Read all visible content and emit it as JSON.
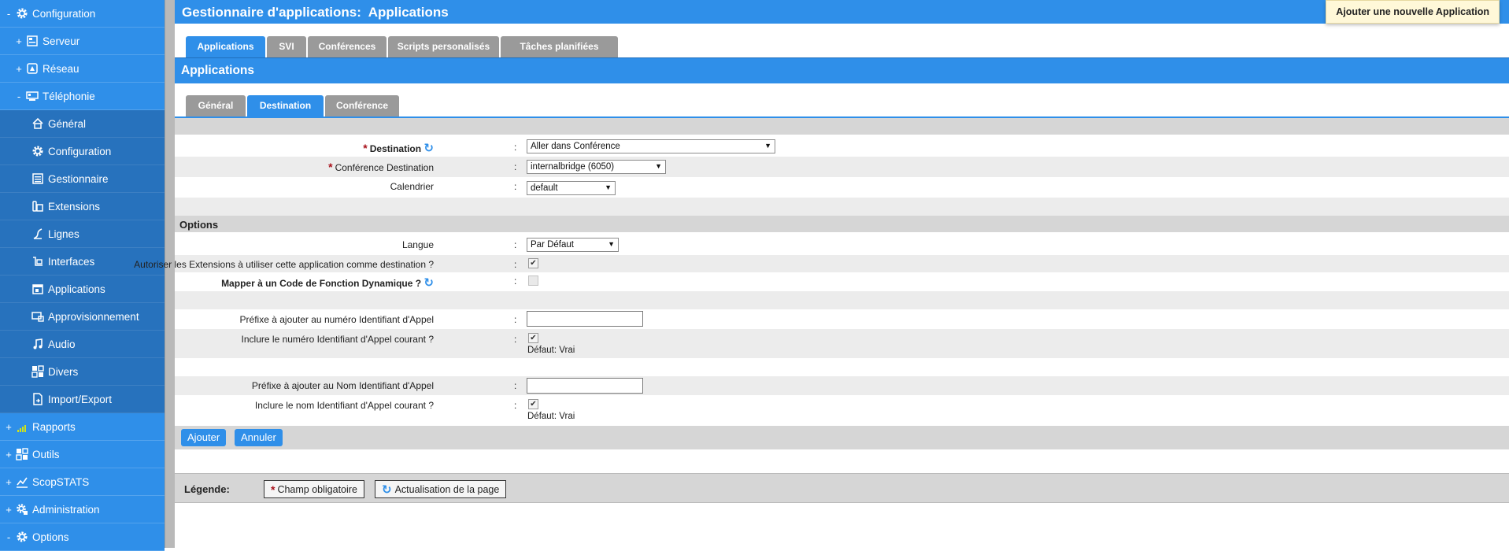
{
  "sidebar": {
    "items": [
      {
        "toggle": "-",
        "icon": "gear-icon",
        "label": "Configuration"
      },
      {
        "toggle": "+",
        "icon": "server-icon",
        "label": "Serveur"
      },
      {
        "toggle": "+",
        "icon": "network-icon",
        "label": "Réseau"
      },
      {
        "toggle": "-",
        "icon": "telephony-icon",
        "label": "Téléphonie"
      },
      {
        "toggle": "",
        "icon": "home-icon",
        "label": "Général"
      },
      {
        "toggle": "",
        "icon": "gear-icon",
        "label": "Configuration"
      },
      {
        "toggle": "",
        "icon": "manager-icon",
        "label": "Gestionnaire"
      },
      {
        "toggle": "",
        "icon": "phone-icon",
        "label": "Extensions"
      },
      {
        "toggle": "",
        "icon": "lines-icon",
        "label": "Lignes"
      },
      {
        "toggle": "",
        "icon": "interfaces-icon",
        "label": "Interfaces"
      },
      {
        "toggle": "",
        "icon": "applications-icon",
        "label": "Applications"
      },
      {
        "toggle": "",
        "icon": "provisioning-icon",
        "label": "Approvisionnement"
      },
      {
        "toggle": "",
        "icon": "music-note-icon",
        "label": "Audio"
      },
      {
        "toggle": "",
        "icon": "misc-icon",
        "label": "Divers"
      },
      {
        "toggle": "",
        "icon": "import-export-icon",
        "label": "Import/Export"
      },
      {
        "toggle": "+",
        "icon": "chart-bars-icon",
        "label": "Rapports"
      },
      {
        "toggle": "+",
        "icon": "tools-icon",
        "label": "Outils"
      },
      {
        "toggle": "+",
        "icon": "stats-icon",
        "label": "ScopSTATS"
      },
      {
        "toggle": "+",
        "icon": "admin-gear-icon",
        "label": "Administration"
      },
      {
        "toggle": "-",
        "icon": "gear-icon",
        "label": "Options"
      }
    ]
  },
  "header": {
    "title": "Gestionnaire d'applications:  Applications",
    "add_button": "Ajouter une nouvelle Application"
  },
  "main_tabs": [
    "Applications",
    "SVI",
    "Conférences",
    "Scripts personalisés",
    "Tâches planifiées"
  ],
  "section_title": "Applications",
  "sub_tabs": [
    "Général",
    "Destination",
    "Conférence"
  ],
  "form": {
    "colon": ":",
    "destination": {
      "label": "Destination",
      "value": "Aller dans Conférence"
    },
    "conference_destination": {
      "label": "Conférence Destination",
      "value": "internalbridge (6050)"
    },
    "calendar": {
      "label": "Calendrier",
      "value": "default"
    },
    "options_title": "Options",
    "language": {
      "label": "Langue",
      "value": "Par Défaut"
    },
    "allow_extensions": {
      "label": "Autoriser les Extensions à utiliser cette application comme destination ?",
      "checked": true
    },
    "map_feature_code": {
      "label": "Mapper à un Code de Fonction Dynamique ?",
      "checked": false
    },
    "cid_number_prefix": {
      "label": "Préfixe à ajouter au numéro Identifiant d'Appel",
      "value": ""
    },
    "include_cid_number": {
      "label": "Inclure le numéro Identifiant d'Appel courant ?",
      "checked": true,
      "hint": "Défaut: Vrai"
    },
    "cid_name_prefix": {
      "label": "Préfixe à ajouter au Nom Identifiant d'Appel",
      "value": ""
    },
    "include_cid_name": {
      "label": "Inclure le nom Identifiant d'Appel courant ?",
      "checked": true,
      "hint": "Défaut: Vrai"
    }
  },
  "buttons": {
    "add": "Ajouter",
    "cancel": "Annuler"
  },
  "legend": {
    "title": "Légende:",
    "required": "Champ obligatoire",
    "refresh": "Actualisation de la page"
  },
  "symbols": {
    "required": "*",
    "refresh": "↻",
    "dropdown": "▼",
    "check": "✔"
  },
  "colors": {
    "accent": "#2f8fe9",
    "sidebar_sub": "#2772bd",
    "required": "#a8101a",
    "add_button_bg": "#fff8d8"
  }
}
